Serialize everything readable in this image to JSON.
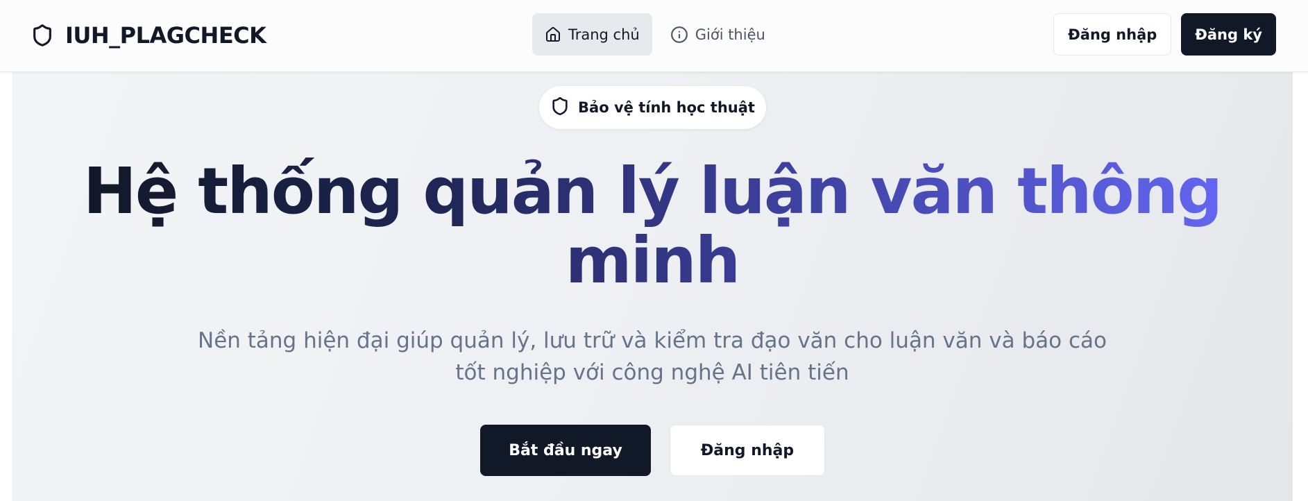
{
  "navbar": {
    "brand": {
      "icon": "shield-icon",
      "title": "IUH_PLAGCHECK"
    },
    "links": [
      {
        "label": "Trang chủ",
        "icon": "home-icon",
        "active": true
      },
      {
        "label": "Giới thiệu",
        "icon": "info-icon",
        "active": false
      }
    ],
    "login_label": "Đăng nhập",
    "register_label": "Đăng ký"
  },
  "hero": {
    "badge": {
      "icon": "shield-icon",
      "label": "Bảo vệ tính học thuật"
    },
    "headline": "Hệ thống quản lý luận văn thông minh",
    "subtitle": "Nền tảng hiện đại giúp quản lý, lưu trữ và kiểm tra đạo văn cho luận văn và báo cáo tốt nghiệp với công nghệ AI tiên tiến",
    "primary_cta": "Bắt đầu ngay",
    "secondary_cta": "Đăng nhập"
  },
  "colors": {
    "dark": "#111827",
    "accent": "#6366f1",
    "muted_text": "#64748b"
  }
}
